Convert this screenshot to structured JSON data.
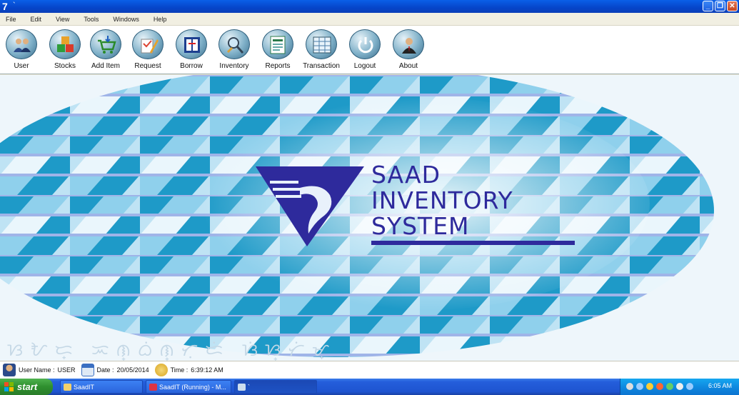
{
  "window": {
    "title_icon_glyph": "7",
    "title": "`",
    "minimize_glyph": "_",
    "maximize_glyph": "❐",
    "close_glyph": "✕"
  },
  "menu": {
    "items": [
      "File",
      "Edit",
      "View",
      "Tools",
      "Windows",
      "Help"
    ]
  },
  "toolbar": {
    "buttons": [
      {
        "label": "User",
        "icon": "users-icon"
      },
      {
        "label": "Stocks",
        "icon": "boxes-icon"
      },
      {
        "label": "Add Item",
        "icon": "cart-add-icon"
      },
      {
        "label": "Request",
        "icon": "pen-paper-icon"
      },
      {
        "label": "Borrow",
        "icon": "document-exchange-icon"
      },
      {
        "label": "Inventory",
        "icon": "inventory-search-icon"
      },
      {
        "label": "Reports",
        "icon": "report-icon"
      },
      {
        "label": "Transaction",
        "icon": "spreadsheet-icon"
      },
      {
        "label": "Logout",
        "icon": "power-icon"
      },
      {
        "label": "About",
        "icon": "person-icon"
      }
    ]
  },
  "banner": {
    "title_line1": "SAAD",
    "title_line2": "INVENTORY",
    "title_line3": "SYSTEM",
    "script_text": "ᜐᜀᜇ᜔ ᜁᜈ᜔ᜊᜒᜈ᜔ᜆᜓᜇᜒ ᜐᜒᜐ᜔ᜆᜒᜋ᜔",
    "colors": {
      "pattern_dark": "#1e9ac8",
      "pattern_light": "#9fd6ef",
      "logo": "#2e2a9c"
    }
  },
  "status": {
    "user_label": "User Name :",
    "user_value": "USER",
    "date_label": "Date :",
    "date_value": "20/05/2014",
    "time_label": "Time :",
    "time_value": "6:39:12 AM"
  },
  "taskbar": {
    "start_label": "start",
    "tasks": [
      {
        "label": "SaadIT"
      },
      {
        "label": "SaadIT (Running) - M..."
      },
      {
        "label": "`"
      }
    ],
    "clock": "6:05 AM"
  }
}
